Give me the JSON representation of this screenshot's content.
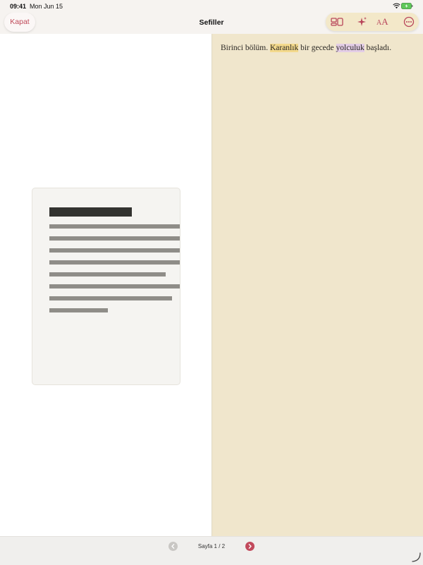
{
  "status_bar": {
    "time": "09:41",
    "date": "Mon Jun 15",
    "wifi_icon": "wifi-icon",
    "battery_icon": "battery-icon"
  },
  "nav": {
    "title": "Sefiller",
    "close_label": "Kapat",
    "toolbar_icons": [
      "layout-icon",
      "sparkle-icon",
      "text-size-icon",
      "more-icon"
    ],
    "text_size_small": "A",
    "text_size_big": "A"
  },
  "reading": {
    "before": "Birinci bölüm. ",
    "highlight_1": "Karanlık",
    "middle": " bir gecede ",
    "highlight_2": "yolculuk",
    "after": " başladı."
  },
  "bottom": {
    "page_label": "Sayfa 1 / 2"
  },
  "colors": {
    "accent": "#c24a5a",
    "reading_bg": "#f0e6cc",
    "highlight_yellow": "#f3d98c",
    "highlight_purple": "#e3cde6"
  }
}
